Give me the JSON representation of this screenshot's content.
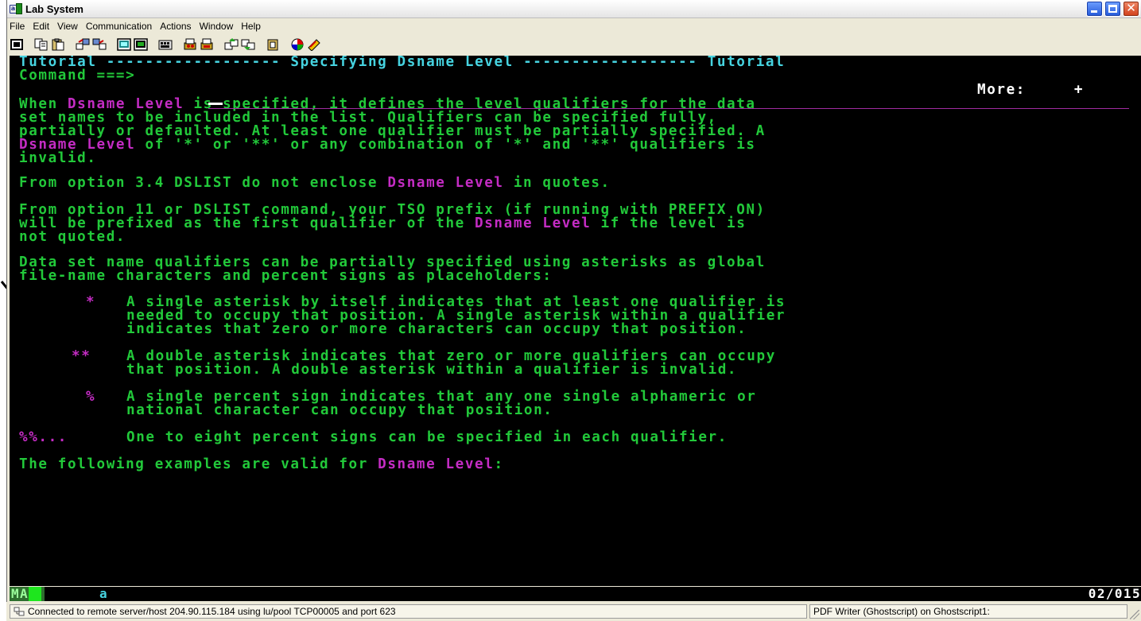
{
  "window": {
    "title": "Lab System",
    "controls": [
      "minimize",
      "maximize",
      "close"
    ]
  },
  "menubar": {
    "items": [
      "File",
      "Edit",
      "View",
      "Communication",
      "Actions",
      "Window",
      "Help"
    ]
  },
  "toolbar": {
    "icons": [
      "screen-icon",
      "copy-icon",
      "paste-icon",
      "send-icon",
      "receive-icon",
      "macro-record-icon",
      "macro-play-icon",
      "keypad-icon",
      "print-screen-icon",
      "print-icon",
      "transfer-up-icon",
      "transfer-down-icon",
      "clipboard-icon",
      "color-icon",
      "help-icon"
    ]
  },
  "terminal": {
    "header": {
      "left": "Tutorial",
      "dashes_left": "------------------",
      "title": "Specifying Dsname Level",
      "dashes_right": "------------------",
      "right": "Tutorial"
    },
    "command": {
      "label": "Command ===>",
      "value": ""
    },
    "more_indicator": "More:     +",
    "p1": {
      "l1a": "When ",
      "l1b": "Dsname Level",
      "l1c": " is specified, it defines the level qualifiers for the data",
      "l2": "set names to be included in the list. Qualifiers can be specified fully,",
      "l3": "partially or defaulted. At least one qualifier must be partially specified. A",
      "l4a": "Dsname Level",
      "l4b": " of '*' or '**' or any combination of '*' and '**' qualifiers is",
      "l5": "invalid."
    },
    "p2": {
      "a": "From option 3.4 DSLIST do not enclose ",
      "b": "Dsname Level",
      "c": " in quotes."
    },
    "p3": {
      "l1": "From option 11 or DSLIST command, your TSO prefix (if running with PREFIX ON)",
      "l2a": "will be prefixed as the first qualifier of the ",
      "l2b": "Dsname Level",
      "l2c": " if the level is",
      "l3": "not quoted."
    },
    "p4": {
      "l1": "Data set name qualifiers can be partially specified using asterisks as global",
      "l2": "file-name characters and percent signs as placeholders:"
    },
    "items": [
      {
        "symbol": "*",
        "lines": [
          "A single asterisk by itself indicates that at least one qualifier is",
          "needed to occupy that position. A single asterisk within a qualifier",
          "indicates that zero or more characters can occupy that position."
        ]
      },
      {
        "symbol": "**",
        "lines": [
          "A double asterisk indicates that zero or more qualifiers can occupy",
          "that position. A double asterisk within a qualifier is invalid."
        ]
      },
      {
        "symbol": "%",
        "lines": [
          "A single percent sign indicates that any one single alphameric or",
          "national character can occupy that position."
        ]
      },
      {
        "symbol": "%%...",
        "lines": [
          "One to eight percent signs can be specified in each qualifier."
        ]
      }
    ],
    "p5": {
      "a": "The following examples are valid for ",
      "b": "Dsname Level",
      "c": ":"
    }
  },
  "oia": {
    "mode": "MA",
    "session_letter": "a",
    "cursor_position": "02/015"
  },
  "statusbar": {
    "connection": "Connected to remote server/host 204.90.115.184 using lu/pool TCP00005 and port 623",
    "printer": "PDF Writer (Ghostscript) on Ghostscript1:"
  },
  "colors": {
    "terminal_bg": "#000000",
    "text_green": "#22c93a",
    "text_magenta": "#c42cc4",
    "text_white": "#ffffff",
    "text_turquoise": "#46d3e0"
  }
}
